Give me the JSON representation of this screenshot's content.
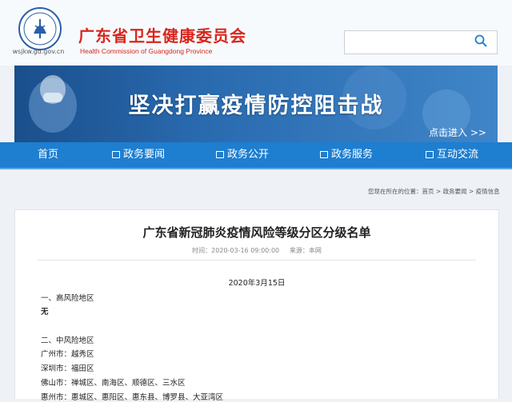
{
  "header": {
    "logo_url_text": "wsjkw.gd.gov.cn",
    "title": "广东省卫生健康委员会",
    "subtitle": "Health Commission of Guangdong Province",
    "search": {
      "placeholder": ""
    }
  },
  "banner": {
    "title": "坚决打赢疫情防控阻击战",
    "link": "点击进入 >>"
  },
  "nav": {
    "home": "首页",
    "items": [
      "政务要闻",
      "政务公开",
      "政务服务",
      "互动交流"
    ]
  },
  "breadcrumb": {
    "prefix": "您现在所在的位置：",
    "items": [
      "首页",
      "政务要闻",
      "疫情信息"
    ],
    "sep": " > "
  },
  "article": {
    "title": "广东省新冠肺炎疫情风险等级分区分级名单",
    "meta": "时间：2020-03-16 09:00:00     来源：本网",
    "date": "2020年3月15日",
    "high_risk_heading": "一、高风险地区",
    "high_risk_value": "无",
    "mid_risk_heading": "二、中风险地区",
    "mid_risk_lines": [
      "广州市：越秀区",
      "深圳市：福田区",
      "佛山市：禅城区、南海区、顺德区、三水区",
      "惠州市：惠城区、惠阳区、惠东县、博罗县、大亚湾区"
    ]
  },
  "colors": {
    "brand_red": "#d9261c",
    "nav_blue": "#1e7ed0"
  }
}
